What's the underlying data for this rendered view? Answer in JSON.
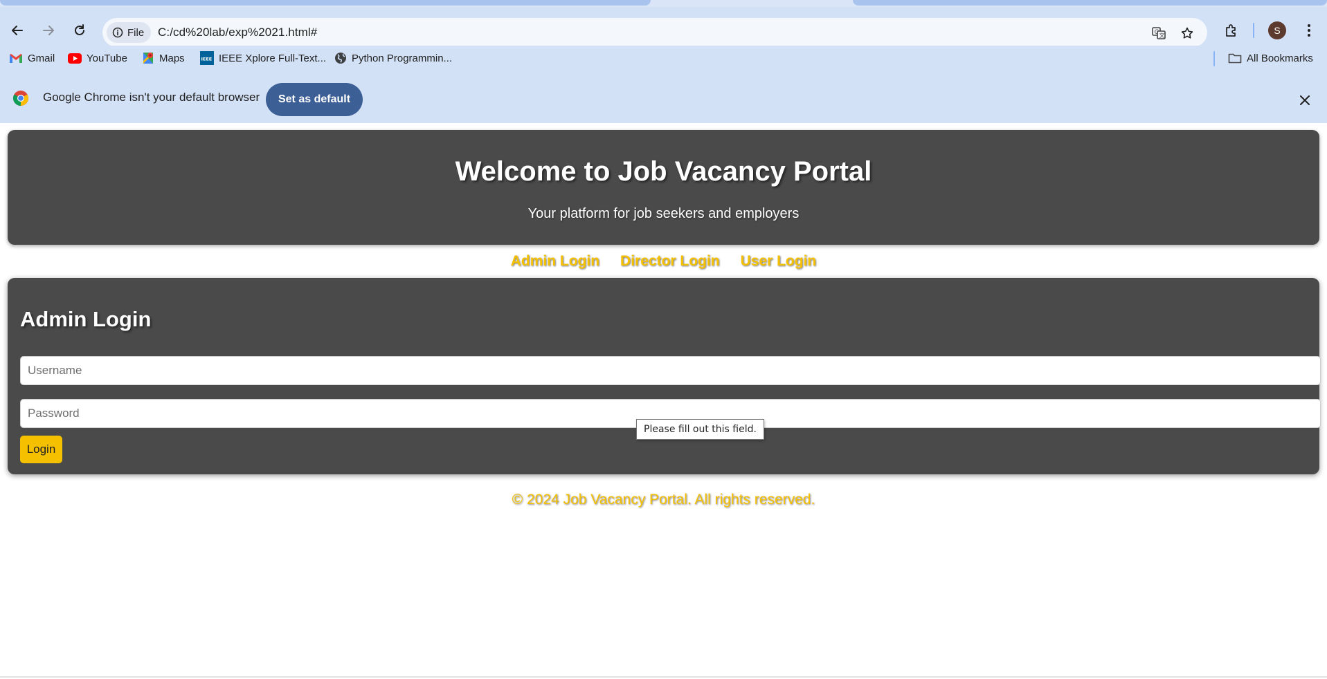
{
  "browser": {
    "site_chip_label": "File",
    "url": "C:/cd%20lab/exp%2021.html#",
    "profile_initial": "S",
    "bookmarks": [
      {
        "label": "Gmail",
        "icon": "gmail-icon"
      },
      {
        "label": "YouTube",
        "icon": "youtube-icon"
      },
      {
        "label": "Maps",
        "icon": "maps-icon"
      },
      {
        "label": "IEEE Xplore Full-Text...",
        "icon": "ieee-icon"
      },
      {
        "label": "Python Programmin...",
        "icon": "globe-icon"
      }
    ],
    "all_bookmarks_label": "All Bookmarks",
    "infobar": {
      "message": "Google Chrome isn't your default browser",
      "button_label": "Set as default"
    }
  },
  "header": {
    "title": "Welcome to Job Vacancy Portal",
    "subtitle": "Your platform for job seekers and employers"
  },
  "nav": {
    "links": [
      "Admin Login",
      "Director Login",
      "User Login"
    ]
  },
  "login": {
    "title": "Admin Login",
    "username_placeholder": "Username",
    "password_placeholder": "Password",
    "button_label": "Login",
    "validation_tooltip": "Please fill out this field."
  },
  "footer": {
    "text": "© 2024 Job Vacancy Portal. All rights reserved."
  },
  "colors": {
    "accent": "#f5c000",
    "panel": "#4a4a4a",
    "chrome": "#d3e1f6",
    "set_default_button": "#3c5f96"
  }
}
